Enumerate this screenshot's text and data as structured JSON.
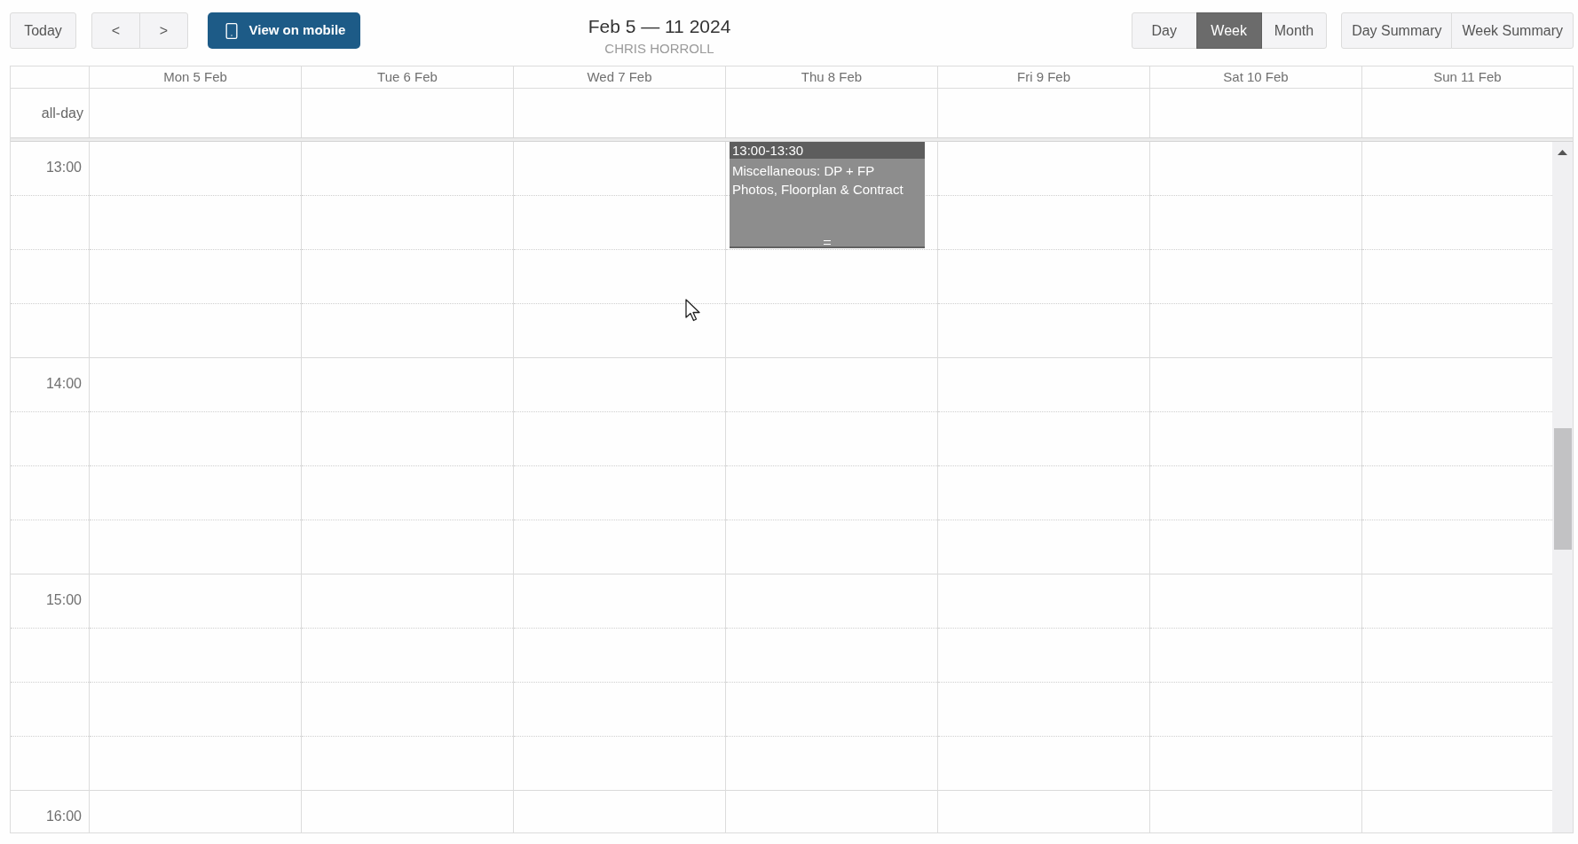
{
  "toolbar": {
    "today": {
      "label": "Today"
    },
    "nav": [
      {
        "label": "<"
      },
      {
        "label": ">"
      }
    ],
    "mobile_button": {
      "label": "View on mobile"
    },
    "title": "Feb 5 — 11 2024",
    "subtitle": "CHRIS HORROLL",
    "views": [
      {
        "label": "Day",
        "selected": false
      },
      {
        "label": "Week",
        "selected": true
      },
      {
        "label": "Month",
        "selected": false
      }
    ],
    "summaries": [
      {
        "label": "Day Summary"
      },
      {
        "label": "Week Summary"
      }
    ]
  },
  "calendar": {
    "all_day_label": "all-day",
    "days": [
      {
        "label": "Mon 5 Feb"
      },
      {
        "label": "Tue 6 Feb"
      },
      {
        "label": "Wed 7 Feb"
      },
      {
        "label": "Thu 8 Feb",
        "events": [
          {
            "time": "13:00-13:30",
            "title": "Miscellaneous: DP + FP Photos, Floorplan & Contract"
          }
        ]
      },
      {
        "label": "Fri 9 Feb"
      },
      {
        "label": "Sat 10 Feb"
      },
      {
        "label": "Sun 11 Feb"
      }
    ],
    "hours": [
      "13:00",
      "14:00",
      "15:00",
      "16:00"
    ]
  }
}
